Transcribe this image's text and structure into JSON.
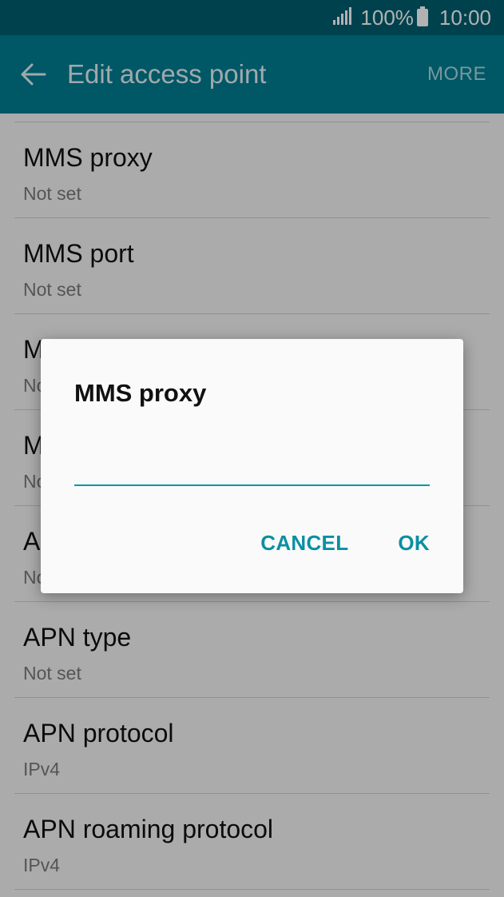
{
  "status_bar": {
    "battery_level": "100%",
    "time": "10:00",
    "signal_icon": "signal-icon",
    "battery_icon": "battery-icon"
  },
  "app_bar": {
    "title": "Edit access point",
    "more_label": "MORE",
    "back_icon": "arrow-back-icon"
  },
  "list": {
    "items": [
      {
        "title": "MMS proxy",
        "subtitle": "Not set"
      },
      {
        "title": "MMS port",
        "subtitle": "Not set"
      },
      {
        "title": "M",
        "subtitle": "No"
      },
      {
        "title": "M",
        "subtitle": "No"
      },
      {
        "title": "A",
        "subtitle": "No"
      },
      {
        "title": "APN type",
        "subtitle": "Not set"
      },
      {
        "title": "APN protocol",
        "subtitle": "IPv4"
      },
      {
        "title": "APN roaming protocol",
        "subtitle": "IPv4"
      }
    ]
  },
  "dialog": {
    "title": "MMS proxy",
    "input_value": "",
    "cancel_label": "CANCEL",
    "ok_label": "OK"
  },
  "colors": {
    "status_bar": "#015d70",
    "app_bar": "#007d93",
    "accent": "#0a8fa3"
  }
}
